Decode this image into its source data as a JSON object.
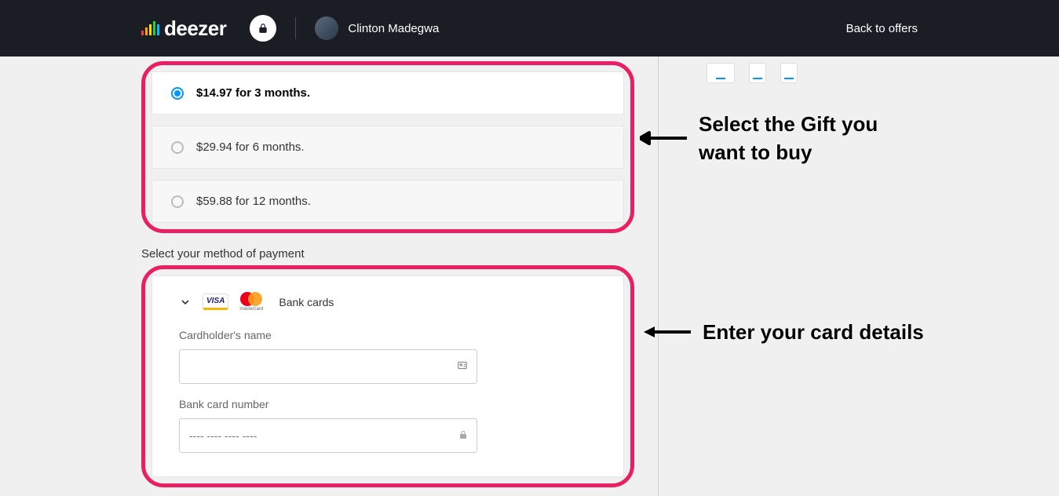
{
  "header": {
    "brand": "deezer",
    "username": "Clinton Madegwa",
    "back_link": "Back to offers"
  },
  "gift_options": [
    {
      "label": "$14.97 for 3 months.",
      "selected": true
    },
    {
      "label": "$29.94 for 6 months.",
      "selected": false
    },
    {
      "label": "$59.88 for 12 months.",
      "selected": false
    }
  ],
  "payment": {
    "section_label": "Select your method of payment",
    "method_label": "Bank cards",
    "cardholder_label": "Cardholder's name",
    "cardnumber_label": "Bank card number",
    "cardnumber_placeholder": "---- ---- ---- ----"
  },
  "annotations": {
    "gift": "Select the Gift you want to buy",
    "card": "Enter your card details"
  }
}
